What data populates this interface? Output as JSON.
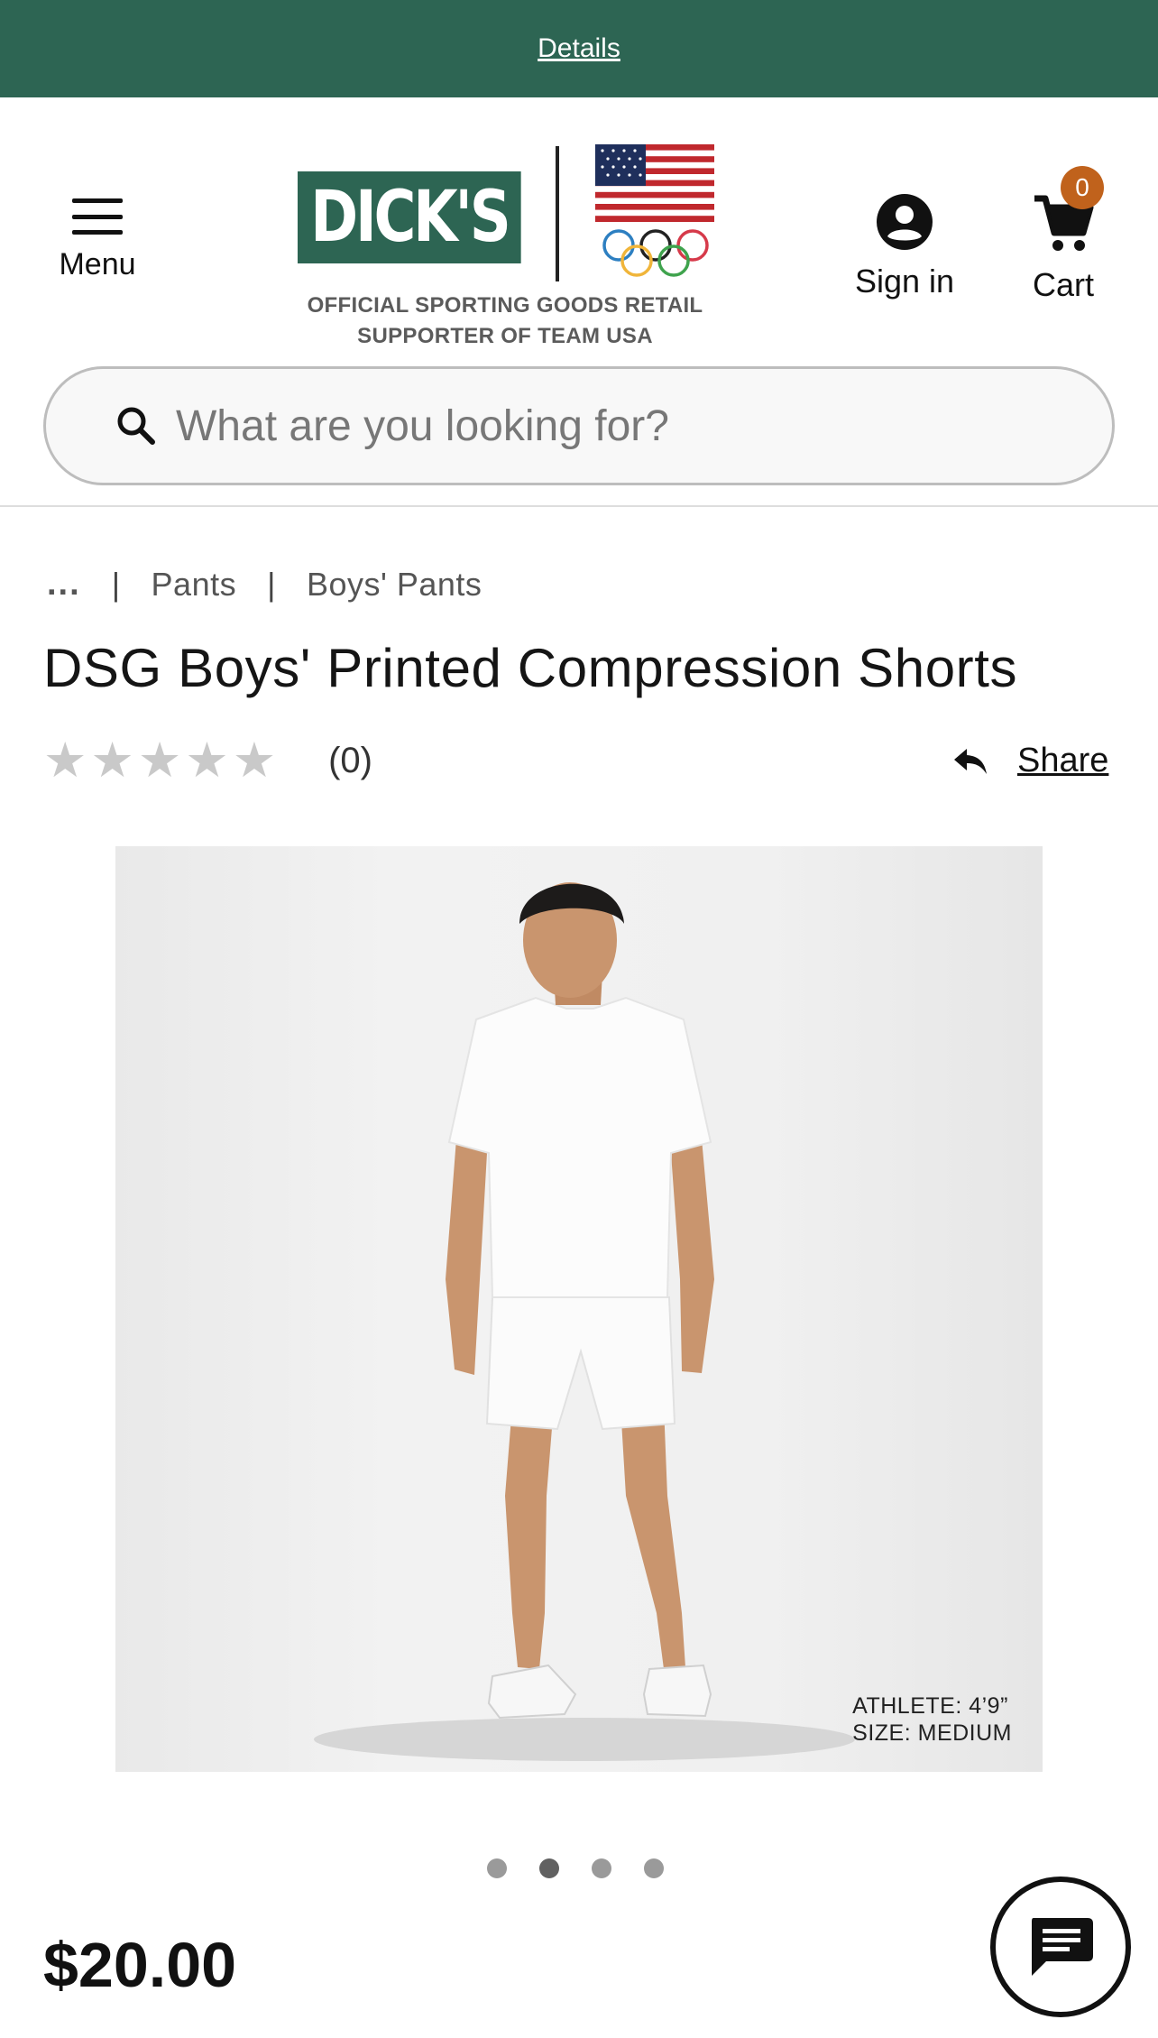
{
  "promo": {
    "details_link": "Details"
  },
  "header": {
    "menu_label": "Menu",
    "logo_text": "DICK'S",
    "tagline_line1": "OFFICIAL SPORTING GOODS RETAIL",
    "tagline_line2": "SUPPORTER OF TEAM USA",
    "signin_label": "Sign in",
    "cart_label": "Cart",
    "cart_count": "0",
    "brand_color": "#2d6553",
    "badge_color": "#c0621c"
  },
  "search": {
    "placeholder": "What are you looking for?"
  },
  "breadcrumb": {
    "ellipsis": "...",
    "items": [
      "Pants",
      "Boys' Pants"
    ]
  },
  "product": {
    "title": "DSG Boys' Printed Compression Shorts",
    "rating_count": "(0)",
    "stars": 0,
    "share_label": "Share",
    "image_caption_line1": "ATHLETE: 4’9”",
    "image_caption_line2": "SIZE: MEDIUM",
    "image_count": 4,
    "active_image_index": 1,
    "price": "$20.00"
  },
  "icons": {
    "menu": "hamburger-icon",
    "account": "account-circle-icon",
    "cart": "cart-icon",
    "search": "search-icon",
    "share": "share-arrow-icon",
    "chat": "chat-bubble-icon"
  }
}
